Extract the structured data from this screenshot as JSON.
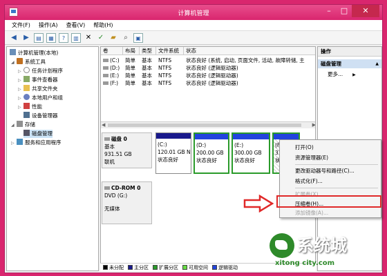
{
  "window": {
    "title": "计算机管理"
  },
  "menubar": [
    "文件(F)",
    "操作(A)",
    "查看(V)",
    "帮助(H)"
  ],
  "tree": {
    "root": "计算机管理(本地)",
    "system_tools": "系统工具",
    "task_scheduler": "任务计划程序",
    "event_viewer": "事件查看器",
    "shared_folders": "共享文件夹",
    "local_users": "本地用户和组",
    "performance": "性能",
    "device_manager": "设备管理器",
    "storage": "存储",
    "disk_management": "磁盘管理",
    "services": "服务和应用程序"
  },
  "volume_table": {
    "headers": [
      "卷",
      "布局",
      "类型",
      "文件系统",
      "状态"
    ],
    "rows": [
      [
        "(C:)",
        "简单",
        "基本",
        "NTFS",
        "状态良好 (系统, 启动, 页面文件, 活动, 故障转储, 主"
      ],
      [
        "(D:)",
        "简单",
        "基本",
        "NTFS",
        "状态良好 (逻辑驱动器)"
      ],
      [
        "(E:)",
        "简单",
        "基本",
        "NTFS",
        "状态良好 (逻辑驱动器)"
      ],
      [
        "(F:)",
        "简单",
        "基本",
        "NTFS",
        "状态良好 (逻辑驱动器)"
      ]
    ]
  },
  "disks": {
    "disk0": {
      "name": "磁盘 0",
      "type": "基本",
      "size": "931.51 GB",
      "status": "联机"
    },
    "cdrom0": {
      "name": "CD-ROM 0",
      "type": "DVD (G:)",
      "status": "无媒体"
    }
  },
  "partitions": [
    {
      "label": "(C:)",
      "size": "120.01 GB N",
      "status": "状态良好"
    },
    {
      "label": "(D:)",
      "size": "200.00 GB",
      "status": "状态良好"
    },
    {
      "label": "(E:)",
      "size": "300.00 GB",
      "status": "状态良好"
    },
    {
      "label": "(F",
      "size": "311",
      "status": "状态"
    }
  ],
  "legend": [
    "未分配",
    "主分区",
    "扩展分区",
    "可用空间",
    "逻辑驱动"
  ],
  "actions": {
    "title": "操作",
    "section": "磁盘管理",
    "more": "更多..."
  },
  "context_menu": {
    "open": "打开(O)",
    "explore": "资源管理器(E)",
    "change_letter": "更改驱动器号和路径(C)...",
    "format": "格式化(F)...",
    "extend": "扩展卷(X)...",
    "shrink": "压缩卷(H)...",
    "add_mirror": "添加镜像(A)..."
  },
  "watermark": {
    "text": "系统城",
    "url": "xitong city.com"
  },
  "colors": {
    "desktop": "#d9266e",
    "unallocated": "#000000",
    "primary": "#1a1a8c",
    "extended": "#2a9a2a",
    "free": "#66dd44",
    "logical": "#2244dd",
    "highlight_box": "#e02828"
  }
}
